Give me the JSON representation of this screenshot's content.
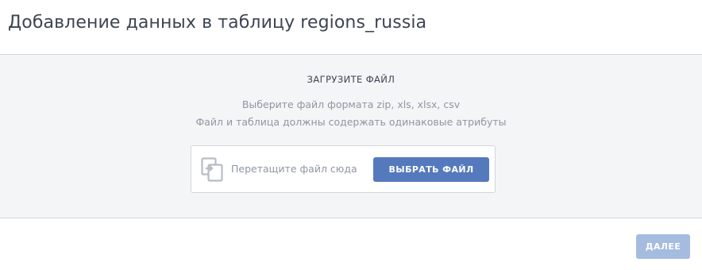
{
  "dialog": {
    "title": "Добавление данных в таблицу regions_russia"
  },
  "upload": {
    "heading": "ЗАГРУЗИТЕ ФАЙЛ",
    "hint_line_1": "Выберите файл формата zip, xls, xlsx, csv",
    "hint_line_2": "Файл и таблица должны содержать одинаковые атрибуты",
    "dropzone": {
      "icon": "file-import-icon",
      "text": "Перетащите файл сюда",
      "button_label": "ВЫБРАТЬ ФАЙЛ"
    }
  },
  "footer": {
    "next_label": "ДАЛЕЕ",
    "next_disabled": true
  },
  "colors": {
    "accent": "#5579bd",
    "accent_disabled": "#a5bbdf",
    "panel_background": "#f4f5f6",
    "muted_text": "#8f96a3",
    "title_text": "#3d4452"
  }
}
